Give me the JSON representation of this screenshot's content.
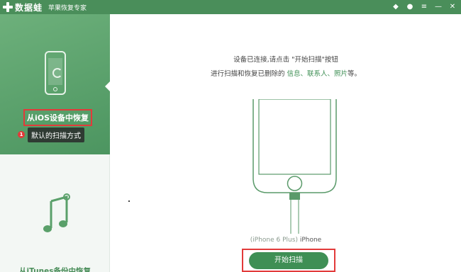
{
  "titlebar": {
    "app_name": "数据蛙",
    "subtitle": "苹果恢复专家",
    "icons": [
      "diamond-icon",
      "chat-icon",
      "menu-icon",
      "minimize-icon",
      "close-icon"
    ]
  },
  "sidebar": {
    "active_item": {
      "label": "从iOS设备中恢复",
      "badge": "1",
      "tooltip": "默认的扫描方式"
    },
    "second_item": {
      "label": "从iTunes备份中恢复"
    }
  },
  "main": {
    "instruction_line1": "设备已连接,请点击 \"开始扫描\"按钮",
    "instruction_line2_prefix": "进行扫描和恢复已删除的",
    "instruction_line2_links": [
      "信息、",
      "联系人、",
      "照片"
    ],
    "instruction_line2_suffix": "等。",
    "device_model": "(iPhone 6 Plus)",
    "device_name": "iPhone",
    "start_button": "开始扫描"
  },
  "colors": {
    "brand_green": "#4a8e5a",
    "highlight_red": "#e23a3a"
  }
}
